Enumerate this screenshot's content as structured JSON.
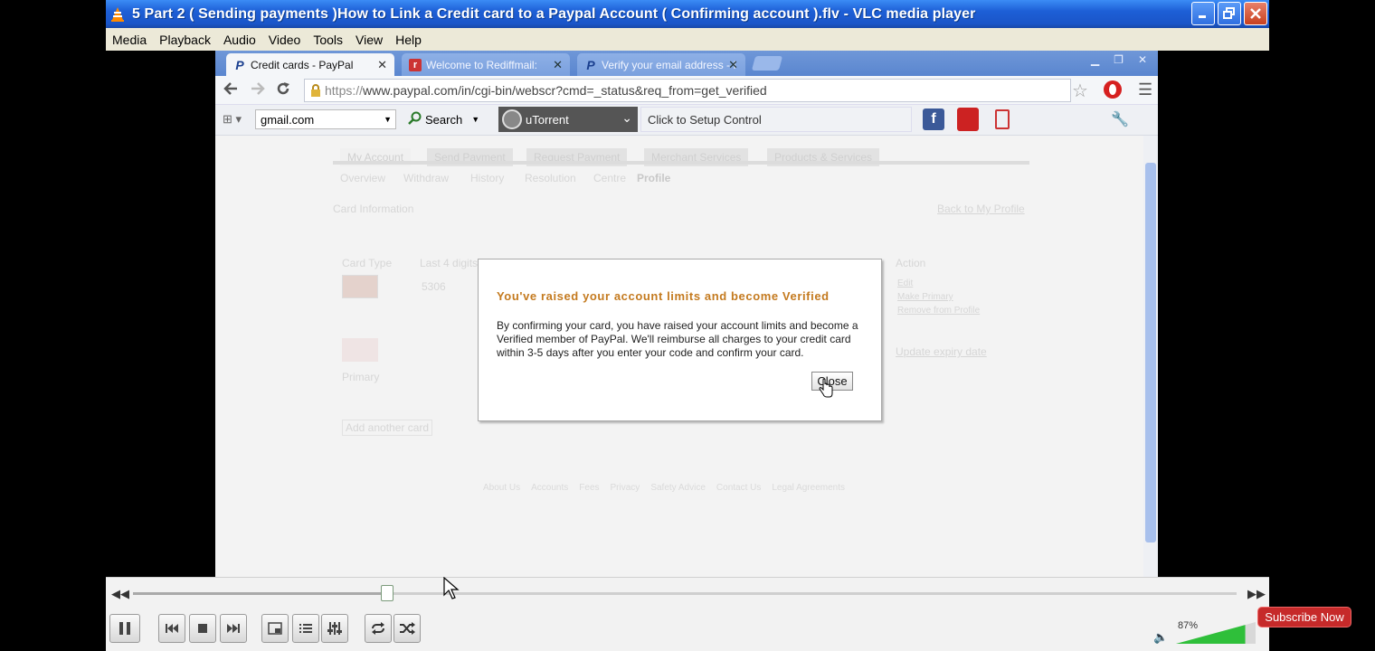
{
  "window": {
    "title": "5 Part 2 ( Sending payments )How to Link a Credit card to a Paypal Account ( Confirming account ).flv - VLC media player"
  },
  "menu": [
    "Media",
    "Playback",
    "Audio",
    "Video",
    "Tools",
    "View",
    "Help"
  ],
  "browser": {
    "tabs": [
      {
        "label": "Credit cards - PayPal",
        "active": true
      },
      {
        "label": "Welcome to Rediffmail:",
        "active": false
      },
      {
        "label": "Verify your email address - I",
        "active": false
      }
    ],
    "url": {
      "scheme": "https://",
      "rest": "www.paypal.com/in/cgi-bin/webscr?cmd=_status&req_from=get_verified"
    },
    "bookmarks": {
      "search_box_value": "gmail.com",
      "search_label": "Search",
      "toolbar_name": "uTorrent",
      "setup_text": "Click to Setup Control"
    }
  },
  "page": {
    "nav_tabs": [
      "My Account",
      "Send Payment",
      "Request Payment",
      "Merchant Services",
      "Products & Services"
    ],
    "sub_nav": [
      "Overview",
      "Withdraw",
      "History",
      "Resolution",
      "Centre",
      "Profile"
    ],
    "section_title": "Card Information",
    "back_link": "Back to My Profile",
    "table_headers": {
      "card_type": "Card Type",
      "last_digits": "Last 4 digits",
      "action": "Action"
    },
    "card_digits": "5306",
    "actions": [
      "Edit",
      "Make Primary",
      "Remove from Profile"
    ],
    "update_link": "Update expiry date",
    "primary_label": "Primary",
    "add_card": "Add another card",
    "footer_links": [
      "About Us",
      "Accounts",
      "Fees",
      "Privacy",
      "Safety Advice",
      "Contact Us",
      "Legal Agreements"
    ]
  },
  "dialog": {
    "title": "You've raised your account limits and become Verified",
    "body": "By confirming your card, you have raised your account limits and become a Verified member of PayPal. We'll reimburse all charges to your credit card within 3-5 days after you enter your code and confirm your card.",
    "close_label": "Close"
  },
  "player": {
    "progress": 0.23,
    "volume_label": "87%",
    "volume": 0.87
  },
  "overlay": {
    "subscribe_label": "Subscribe Now"
  },
  "colors": {
    "xp_title_blue": "#1d5fd6",
    "dialog_title": "#c47a1f",
    "subscribe_red": "#c62a2a",
    "volume_green": "#2fbf3a"
  }
}
